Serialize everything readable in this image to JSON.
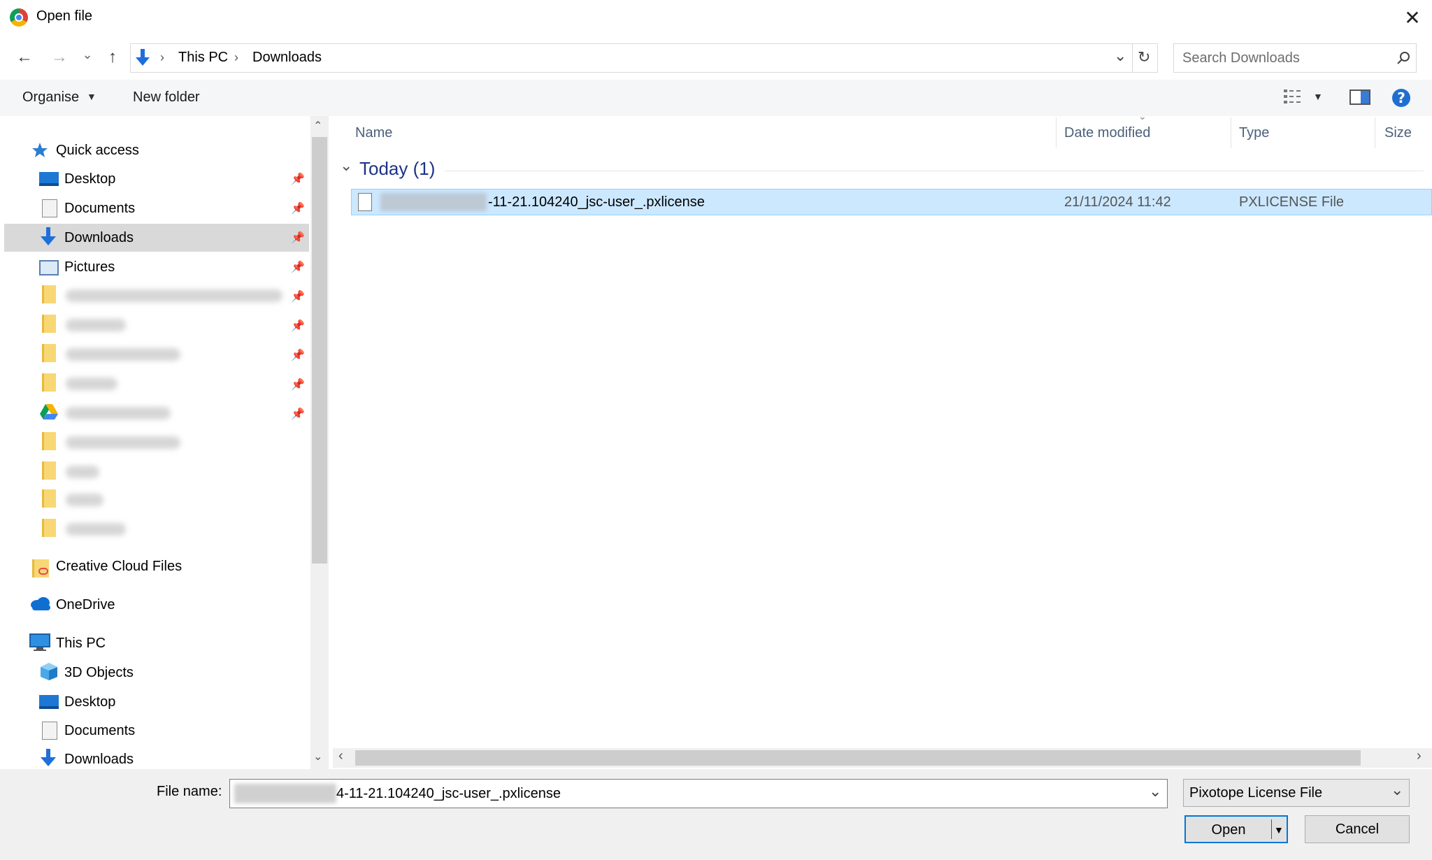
{
  "window": {
    "title": "Open file",
    "close_glyph": "✕"
  },
  "nav": {
    "back": "←",
    "forward": "→",
    "recent": "⌄",
    "up": "↑",
    "breadcrumb": [
      "This PC",
      "Downloads"
    ],
    "refresh": "↻",
    "search_placeholder": "Search Downloads"
  },
  "toolbar": {
    "organise": "Organise",
    "new_folder": "New folder"
  },
  "sidebar": {
    "quick_access": "Quick access",
    "pinned": [
      {
        "label": "Desktop",
        "icon": "desktop-icon"
      },
      {
        "label": "Documents",
        "icon": "documents-icon"
      },
      {
        "label": "Downloads",
        "icon": "downloads-icon",
        "selected": true
      },
      {
        "label": "Pictures",
        "icon": "pictures-icon"
      }
    ],
    "creative_cloud": "Creative Cloud Files",
    "onedrive": "OneDrive",
    "this_pc": "This PC",
    "this_pc_items": [
      {
        "label": "3D Objects",
        "icon": "3d-objects-icon"
      },
      {
        "label": "Desktop",
        "icon": "desktop-icon"
      },
      {
        "label": "Documents",
        "icon": "documents-icon"
      },
      {
        "label": "Downloads",
        "icon": "downloads-icon"
      }
    ]
  },
  "columns": {
    "name": "Name",
    "date": "Date modified",
    "type": "Type",
    "size": "Size"
  },
  "group": {
    "title": "Today (1)"
  },
  "file": {
    "name": "-11-21.104240_jsc-user_.pxlicense",
    "date": "21/11/2024 11:42",
    "type": "PXLICENSE File"
  },
  "footer": {
    "file_name_label": "File name:",
    "file_name_value": "4-11-21.104240_jsc-user_.pxlicense",
    "file_type": "Pixotope License File",
    "open": "Open",
    "cancel": "Cancel"
  },
  "colors": {
    "accent": "#0078d7",
    "selection": "#cce8ff",
    "group_title": "#1e3287"
  }
}
